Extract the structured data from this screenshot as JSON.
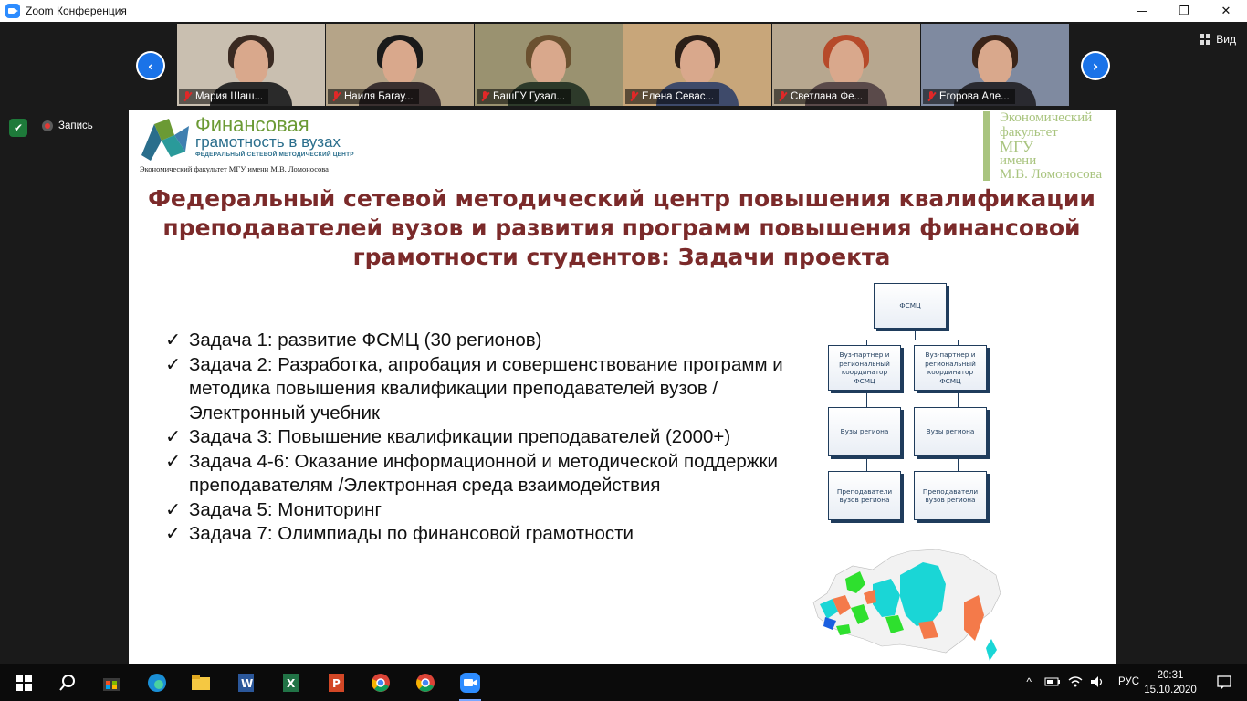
{
  "window": {
    "title": "Zoom Конференция",
    "minimize": "—",
    "maximize": "❐",
    "close": "✕"
  },
  "view_button": {
    "label": "Вид"
  },
  "nav": {
    "prev": "‹",
    "next": "›"
  },
  "participants": [
    {
      "name": "Мария Шаш...",
      "bg": "#c9bfb0",
      "hair": "#3a2a22",
      "body": "#2a2a2a"
    },
    {
      "name": "Наиля Багау...",
      "bg": "#b5a488",
      "hair": "#1a1a1a",
      "body": "#3a3030"
    },
    {
      "name": "БашГУ Гузал...",
      "bg": "#9a9270",
      "hair": "#6b5130",
      "body": "#2d3a2a"
    },
    {
      "name": "Елена Севас...",
      "bg": "#c8a67a",
      "hair": "#2b1f18",
      "body": "#3e4a6a"
    },
    {
      "name": "Светлана Фе...",
      "bg": "#b7a78f",
      "hair": "#b64a2a",
      "body": "#5a4a4a"
    },
    {
      "name": "Егорова Але...",
      "bg": "#7f8aa0",
      "hair": "#3a2418",
      "body": "#2a2a30"
    }
  ],
  "recording": {
    "label": "Запись"
  },
  "slide": {
    "logo": {
      "title": "Финансовая",
      "subtitle": "грамотность в вузах",
      "tagline": "ФЕДЕРАЛЬНЫЙ СЕТЕВОЙ МЕТОДИЧЕСКИЙ ЦЕНТР",
      "footer": "Экономический факультет МГУ имени М.В. Ломоносова"
    },
    "msu_logo": [
      "Экономический",
      "факультет",
      "МГУ",
      "имени",
      "М.В. Ломоносова"
    ],
    "title": "Федеральный сетевой методический центр повышения квалификации преподавателей вузов и развития программ повышения финансовой грамотности студентов: Задачи проекта",
    "tasks": [
      "Задача 1: развитие ФСМЦ (30 регионов)",
      "Задача 2: Разработка, апробация и совершенствование программ и методика повышения квалификации преподавателей вузов / Электронный учебник",
      "Задача 3: Повышение квалификации преподавателей (2000+)",
      "Задача 4-6: Оказание информационной и методической поддержки преподавателям /Электронная среда взаимодействия",
      "Задача 5: Мониторинг",
      "Задача 7: Олимпиады по финансовой грамотности"
    ],
    "checkmark": "✓",
    "org_chart": {
      "root": "ФСМЦ",
      "partner_left": "Вуз-партнер и региональный координатор ФСМЦ",
      "partner_right": "Вуз-партнер и региональный координатор ФСМЦ",
      "region_left": "Вузы региона",
      "region_right": "Вузы региона",
      "teachers_left": "Преподаватели вузов региона",
      "teachers_right": "Преподаватели вузов региона"
    }
  },
  "taskbar": {
    "lang": "РУС",
    "time": "20:31",
    "date": "15.10.2020",
    "tray_up": "^"
  }
}
